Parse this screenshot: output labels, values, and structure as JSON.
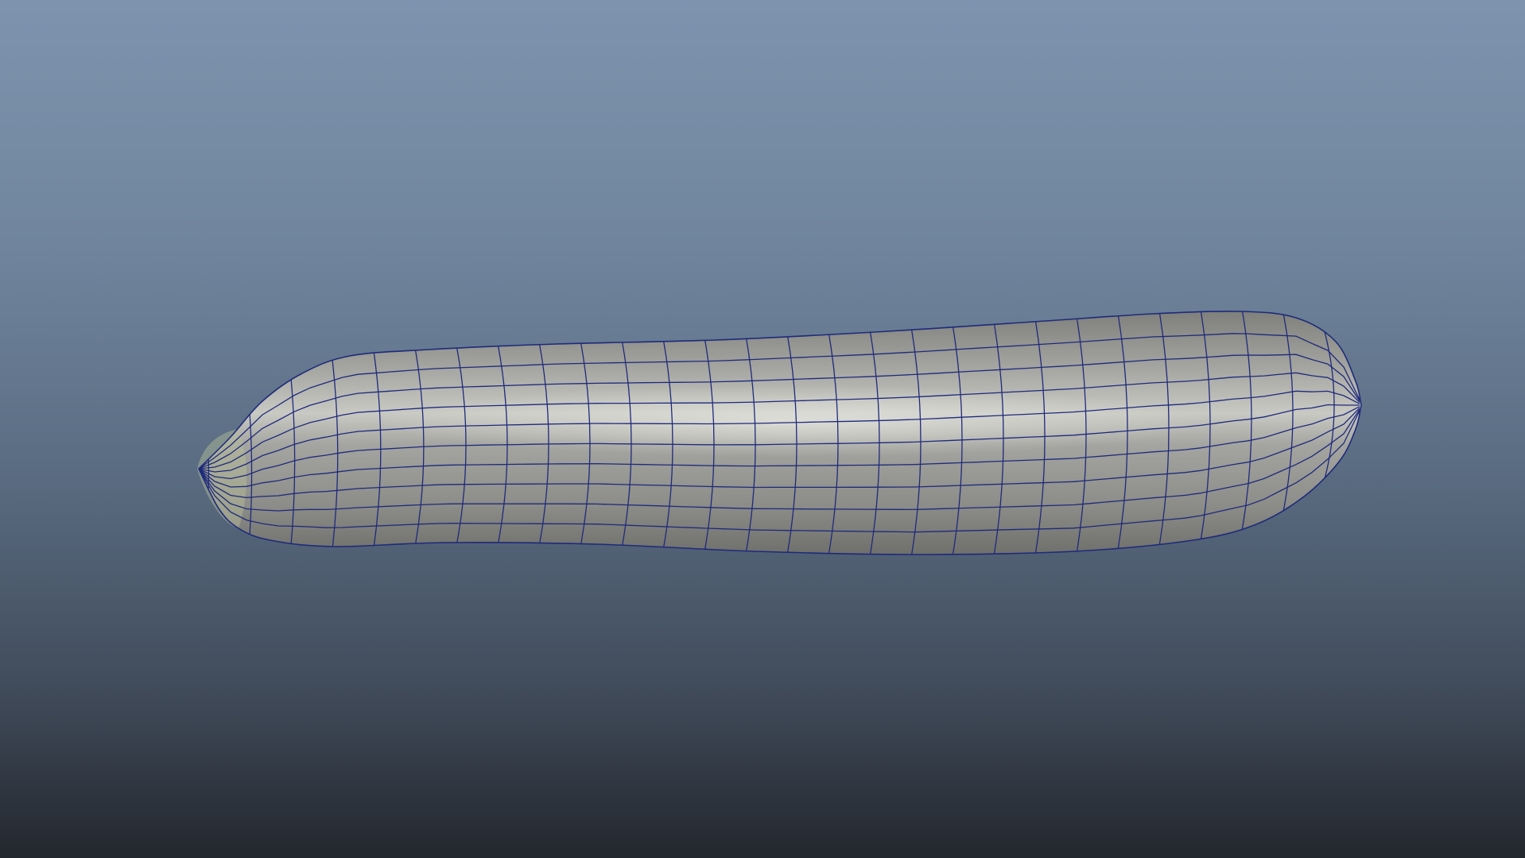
{
  "viewport": {
    "background_top": "#7e94ae",
    "background_bottom": "#23272e"
  },
  "mesh": {
    "object": "cucumber",
    "display_mode": "wireframe-on-shaded",
    "shaded_color": "#9a9a96",
    "wireframe_color": "#1e2a7a",
    "stem_tint": "#b9c29a"
  }
}
